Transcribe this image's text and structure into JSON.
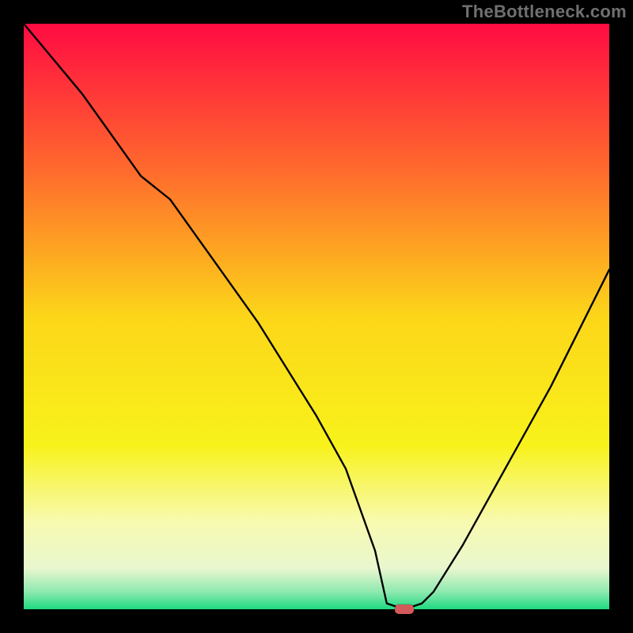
{
  "watermark": "TheBottleneck.com",
  "chart_data": {
    "type": "line",
    "title": "",
    "xlabel": "",
    "ylabel": "",
    "xlim": [
      0,
      100
    ],
    "ylim": [
      0,
      100
    ],
    "x": [
      0,
      5,
      10,
      15,
      20,
      25,
      30,
      35,
      40,
      45,
      50,
      55,
      60,
      62,
      65,
      68,
      70,
      75,
      80,
      85,
      90,
      95,
      100
    ],
    "values": [
      100,
      94,
      88,
      81,
      74,
      70,
      63,
      56,
      49,
      41,
      33,
      24,
      10,
      1,
      0,
      1,
      3,
      11,
      20,
      29,
      38,
      48,
      58
    ],
    "marker": {
      "x": 65,
      "y": 0,
      "color": "#d35a5a"
    },
    "background_gradient": {
      "stops": [
        {
          "y": 0,
          "color": "#ff0b42"
        },
        {
          "y": 25,
          "color": "#ff6a2d"
        },
        {
          "y": 50,
          "color": "#fcd619"
        },
        {
          "y": 72,
          "color": "#f8f21b"
        },
        {
          "y": 85,
          "color": "#f8fab0"
        },
        {
          "y": 93,
          "color": "#e9f7cf"
        },
        {
          "y": 97,
          "color": "#8fe9b0"
        },
        {
          "y": 100,
          "color": "#1ed981"
        }
      ]
    }
  }
}
